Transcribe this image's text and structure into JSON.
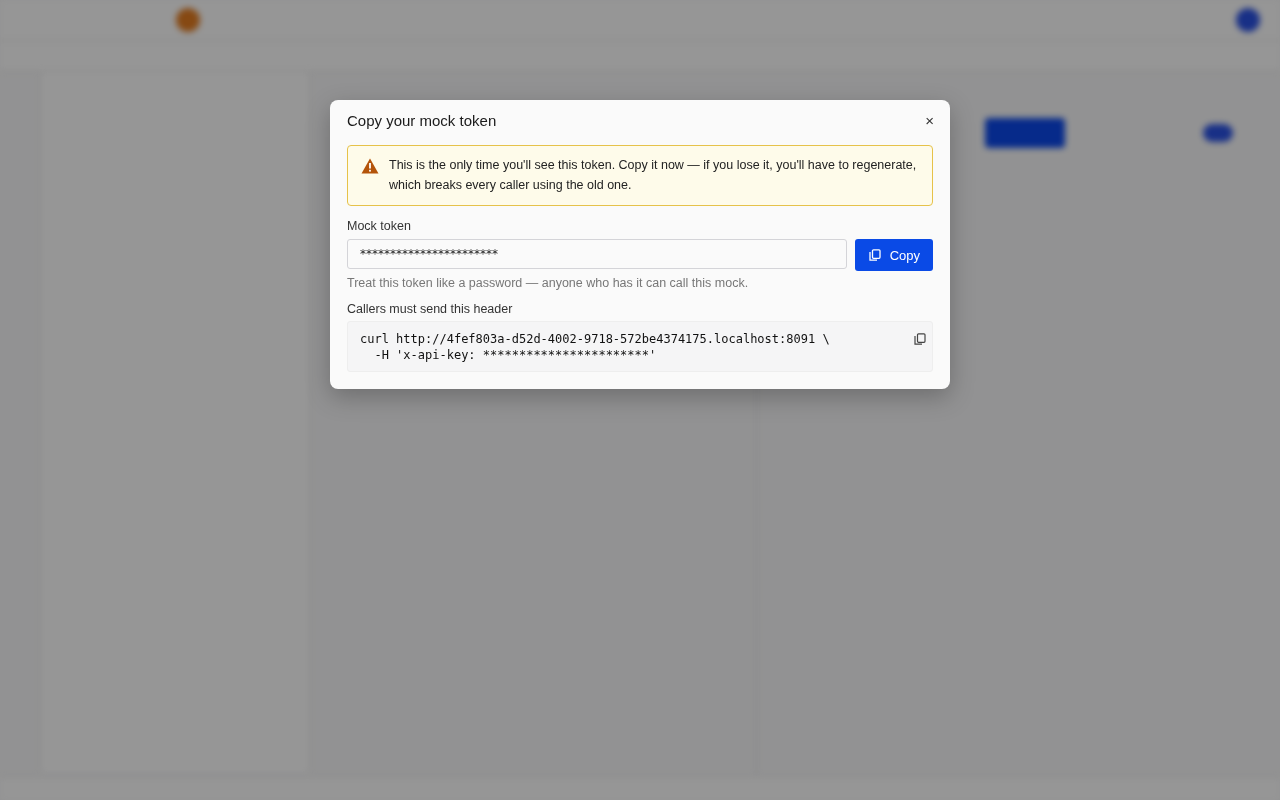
{
  "dialog": {
    "title": "Copy your mock token",
    "close": "×",
    "warning": "This is the only time you'll see this token. Copy it now — if you lose it, you'll have to regenerate, which breaks every caller using the old one.",
    "token_label": "Mock token",
    "token_value": "***********************",
    "copy_button": "Copy",
    "token_hint": "Treat this token like a password — anyone who has it can call this mock.",
    "header_label": "Callers must send this header",
    "code_lines": [
      "curl http://4fef803a-d52d-4002-9718-572be4374175.localhost:8091 \\",
      "  -H 'x-api-key: ***********************'"
    ]
  }
}
